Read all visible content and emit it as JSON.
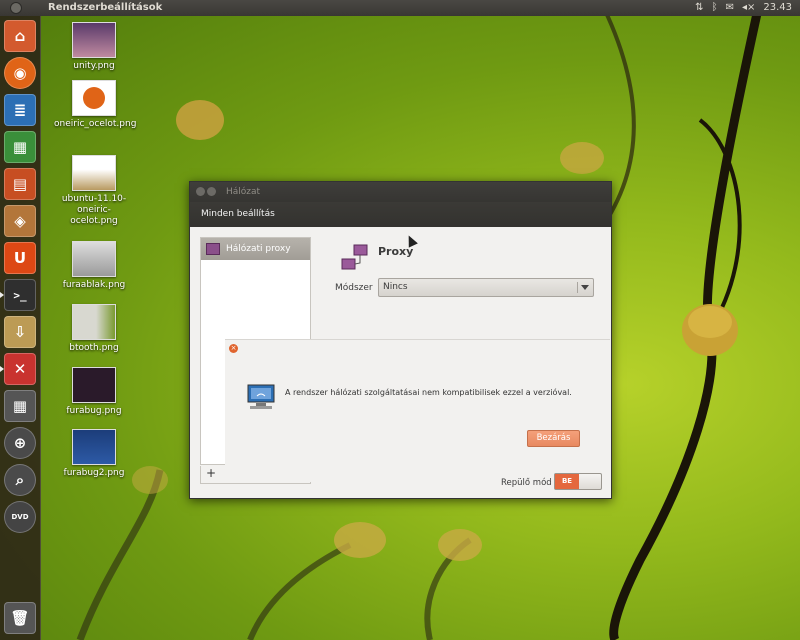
{
  "panel": {
    "app_title": "Rendszerbeállítások",
    "clock": "23.43"
  },
  "launcher": {
    "items": [
      {
        "name": "home-folder",
        "color": "#d35a2e"
      },
      {
        "name": "firefox",
        "color": "#e06417"
      },
      {
        "name": "writer",
        "color": "#2c6fb4"
      },
      {
        "name": "calc",
        "color": "#3a8f3a"
      },
      {
        "name": "impress",
        "color": "#c74e22"
      },
      {
        "name": "software-center",
        "color": "#b3763a"
      },
      {
        "name": "ubuntu-one",
        "color": "#dd4814"
      },
      {
        "name": "terminal",
        "color": "#2f2f2f"
      },
      {
        "name": "update-manager",
        "color": "#bc9b55"
      },
      {
        "name": "system-settings",
        "color": "#c9332f"
      },
      {
        "name": "workspace-switcher",
        "color": "#555555"
      },
      {
        "name": "lens-apps",
        "color": "#4a4a4a"
      },
      {
        "name": "lens-files",
        "color": "#4a4a4a"
      },
      {
        "name": "dvd",
        "color": "#444444"
      },
      {
        "name": "trash",
        "color": "#555555"
      }
    ],
    "dvd_label": "DVD"
  },
  "desktop_icons": [
    {
      "label": "unity.png"
    },
    {
      "label": "oneiric_ocelot.png"
    },
    {
      "label": "ubuntu-11.10-oneiric-ocelot.png"
    },
    {
      "label": "furaablak.png"
    },
    {
      "label": "btooth.png"
    },
    {
      "label": "furabug.png"
    },
    {
      "label": "furabug2.png"
    }
  ],
  "window": {
    "title": "Hálózat",
    "toolbar_button": "Minden beállítás",
    "sidebar": {
      "selected": "Hálózati proxy",
      "add": "+"
    },
    "proxy": {
      "heading": "Proxy",
      "method_label": "Módszer",
      "method_value": "Nincs"
    },
    "error": {
      "message": "A rendszer hálózati szolgáltatásai nem kompatibilisek ezzel a verzióval.",
      "close_button": "Bezárás"
    },
    "airplane_mode": {
      "label": "Repülő mód",
      "state": "BE"
    }
  }
}
